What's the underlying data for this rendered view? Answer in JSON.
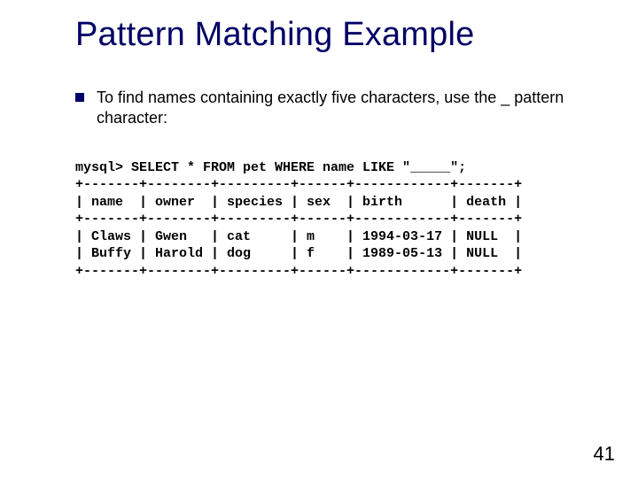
{
  "title": "Pattern Matching Example",
  "bullet": "To find names containing exactly five characters, use the _ pattern character:",
  "sql": {
    "prompt": "mysql> SELECT * FROM pet WHERE name LIKE \"_____\";",
    "divider": "+-------+--------+---------+------+------------+-------+",
    "header": "| name  | owner  | species | sex  | birth      | death |",
    "row1": "| Claws | Gwen   | cat     | m    | 1994-03-17 | NULL  |",
    "row2": "| Buffy | Harold | dog     | f    | 1989-05-13 | NULL  |"
  },
  "chart_data": {
    "type": "table",
    "columns": [
      "name",
      "owner",
      "species",
      "sex",
      "birth",
      "death"
    ],
    "rows": [
      [
        "Claws",
        "Gwen",
        "cat",
        "m",
        "1994-03-17",
        "NULL"
      ],
      [
        "Buffy",
        "Harold",
        "dog",
        "f",
        "1989-05-13",
        "NULL"
      ]
    ]
  },
  "page_number": "41"
}
